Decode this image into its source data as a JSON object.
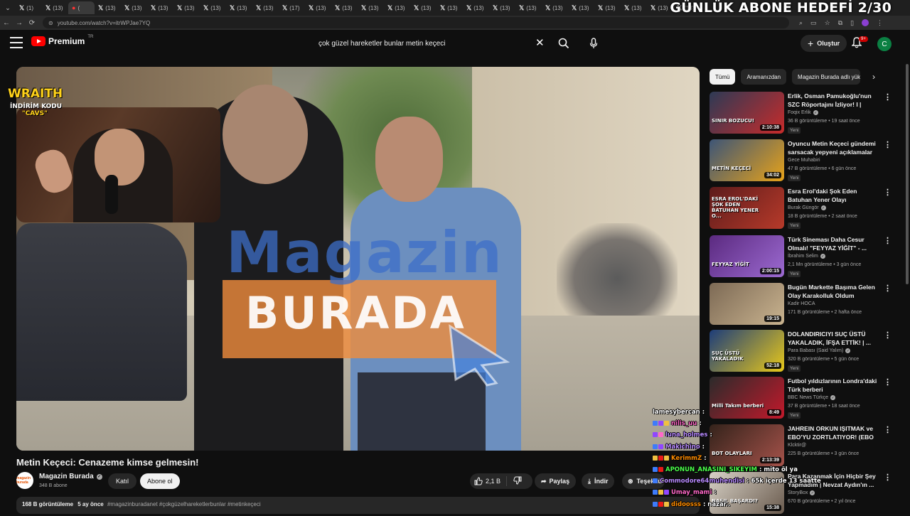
{
  "browser": {
    "tabs": [
      "(1)",
      "(13)",
      "(",
      "(13)",
      "(13)",
      "(13)",
      "(13)",
      "(13)",
      "(13)",
      "(13)",
      "(17)",
      "(13)",
      "(13)",
      "(13)",
      "(13)",
      "(13)",
      "(13)",
      "(13)",
      "(13)",
      "(13)",
      "(13)",
      "(13)",
      "(13)",
      "(13)",
      "(13)",
      "(13)"
    ],
    "active_tab_index": 2,
    "url": "youtube.com/watch?v=itrWPJae7YQ"
  },
  "stream_overlay": {
    "goal": "GÜNLÜK ABONE HEDEFİ 2/30",
    "sponsor": "WRAITH",
    "discount_label": "İNDİRİM KODU",
    "discount_code": "\"CAVS\""
  },
  "header": {
    "logo_text": "Premium",
    "logo_region": "TR",
    "search_query": "çok güzel hareketler bunlar metin keçeci",
    "create_label": "Oluştur",
    "notif_count": "9+",
    "avatar_letter": "C"
  },
  "video": {
    "watermark_top": "Magazin",
    "watermark_bottom": "BURADA",
    "title": "Metin Keçeci: Cenazeme kimse gelmesin!",
    "channel": "Magazin Burada",
    "channel_avatar_text": "magazin burada",
    "subscribers": "348 B abone",
    "join_label": "Katıl",
    "subscribe_label": "Abone ol",
    "likes": "2,1 B",
    "share_label": "Paylaş",
    "download_label": "İndir",
    "thanks_label": "Teşekkürler",
    "views": "168 B görüntüleme",
    "age": "5 ay önce",
    "hashtags": "#magazinburadanet #çokgüzelhareketlerbunlar #metinkeçeci"
  },
  "chips": [
    "Tümü",
    "Aramanızdan",
    "Magazin Burada adlı yüklemeler"
  ],
  "recommendations": [
    {
      "title": "Erlik, Osman Pamukoğlu'nun SZC Röportajını İzliyor! I  | Yayı...",
      "channel": "Foqix Erlik",
      "verified": true,
      "stats": "36 B görüntüleme • 19 saat önce",
      "badge": "Yeni",
      "duration": "2:10:38",
      "thumb_text": "SINIR BOZUCU!",
      "colors": [
        "#2d3a55",
        "#c72b2b"
      ]
    },
    {
      "title": "Oyuncu Metin Keçeci gündemi sarsacak yepyeni açıklamalar ...",
      "channel": "Gece Muhabiri",
      "verified": false,
      "stats": "47 B görüntüleme • 6 gün önce",
      "badge": "Yeni",
      "duration": "34:02",
      "thumb_text": "METİN KEÇECİ",
      "colors": [
        "#3d5577",
        "#e6a21a"
      ]
    },
    {
      "title": "Esra Erol'daki Şok Eden Batuhan Yener Olayı",
      "channel": "Burak Güngör",
      "verified": true,
      "stats": "18 B görüntüleme • 2 saat önce",
      "badge": "Yeni",
      "duration": "",
      "thumb_text": "ESRA EROL'DAKİ ŞOK EDEN BATUHAN YENER O...",
      "colors": [
        "#5c1b1b",
        "#b73a2a"
      ]
    },
    {
      "title": "Türk Sineması Daha Cesur Olmalı! \"FEYYAZ YİĞİT\" - ...",
      "channel": "İbrahim Selim",
      "verified": true,
      "stats": "2,1 Mn görüntüleme • 3 gün önce",
      "badge": "Yeni",
      "duration": "2:00:15",
      "thumb_text": "FEYYAZ YİĞİT",
      "colors": [
        "#5b2a80",
        "#9c6ad1"
      ]
    },
    {
      "title": "Bugün Markette Başıma Gelen Olay Karakolluk Oldum",
      "channel": "Kadir HOCA",
      "verified": false,
      "stats": "171 B görüntüleme • 2 hafta önce",
      "badge": "",
      "duration": "19:15",
      "thumb_text": "",
      "colors": [
        "#7d6a55",
        "#c9b38f"
      ]
    },
    {
      "title": "DOLANDIRICIYI SUÇ ÜSTÜ YAKALADIK, İFŞA ETTİK! | ...",
      "channel": "Para Babası (Said Yalım)",
      "verified": true,
      "stats": "320 B görüntüleme • 5 gün önce",
      "badge": "Yeni",
      "duration": "52:18",
      "thumb_text": "SUÇ ÜSTÜ YAKALADIK",
      "colors": [
        "#1d3d7a",
        "#e8c81a"
      ]
    },
    {
      "title": "Futbol yıldızlarının Londra'daki Türk berberi",
      "channel": "BBC News Türkçe",
      "verified": true,
      "stats": "37 B görüntüleme • 18 saat önce",
      "badge": "Yeni",
      "duration": "8:49",
      "thumb_text": "Milli Takım berberi",
      "colors": [
        "#2b2b2b",
        "#c2192b"
      ]
    },
    {
      "title": "JAHREIN ORKUN IŞITMAK ve EBO'YU ZORTLATIYOR! (EBO ...",
      "channel": "Klcktir@",
      "verified": false,
      "stats": "225 B görüntüleme • 3 gün önce",
      "badge": "",
      "duration": "2:13:39",
      "thumb_text": "BOT OLAYLARI",
      "colors": [
        "#34231b",
        "#a5524a"
      ]
    },
    {
      "title": "Para Kazanmak İçin Hiçbir Şey Yapmadım | Nevzat Aydın'ın ...",
      "channel": "StoryBox",
      "verified": true,
      "stats": "670 B görüntüleme • 2 yıl önce",
      "badge": "",
      "duration": "15:38",
      "thumb_text": "NASIL BAŞARDI?",
      "colors": [
        "#d8d2c7",
        "#6a5b4e"
      ]
    }
  ],
  "chat": [
    {
      "user": "lamesybercan",
      "text": ":",
      "color": "#ffffff",
      "badges": []
    },
    {
      "user": "nilis_uu",
      "text": ":",
      "color": "#ff69c8",
      "badges": [
        "#3e7bfa",
        "#9146ff",
        "#f0c040"
      ]
    },
    {
      "user": "luna_holmes",
      "text": ":",
      "color": "#b98bff",
      "badges": [
        "#9146ff",
        "#ff69c8"
      ]
    },
    {
      "user": "Makichino",
      "text": ":",
      "color": "#b98bff",
      "badges": [
        "#3e7bfa",
        "#9146ff"
      ]
    },
    {
      "user": "KerimmZ",
      "text": ":",
      "color": "#ff8c00",
      "badges": [
        "#f0c040",
        "#e91916",
        "#f0c040"
      ]
    },
    {
      "user": "APONUN_ANASINI_SIKEYIM",
      "text": ": mito öl ya",
      "color": "#4cff4c",
      "badges": [
        "#3e7bfa",
        "#e91916"
      ]
    },
    {
      "user": "Commodore64muhendisi",
      "text": ": 65k içerde 13 saatte",
      "color": "#b98bff",
      "badges": [
        "#3e7bfa"
      ]
    },
    {
      "user": "Umay_mami",
      "text": ":",
      "color": "#ff69c8",
      "badges": [
        "#3e7bfa",
        "#f0c040",
        "#9146ff"
      ]
    },
    {
      "user": "didoosss",
      "text": ": nazar..",
      "color": "#ff8c00",
      "badges": [
        "#3e7bfa",
        "#e91916",
        "#f0c040"
      ]
    }
  ]
}
